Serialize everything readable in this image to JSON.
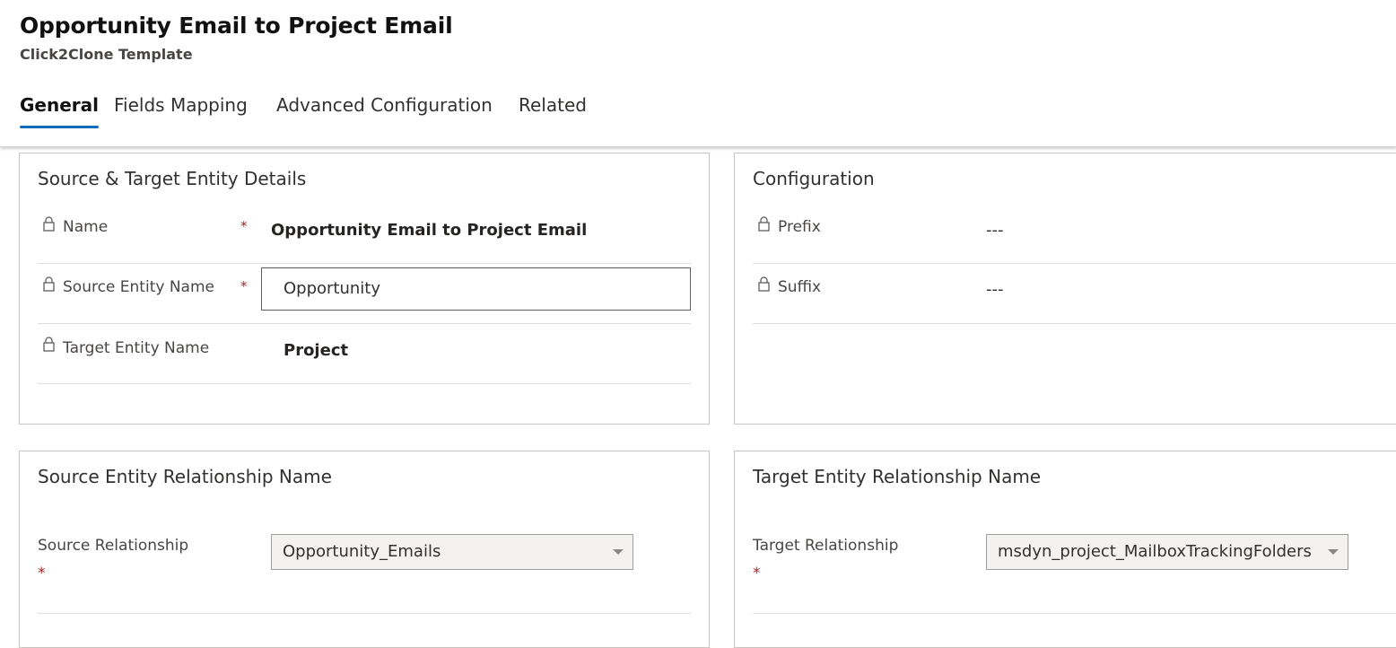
{
  "header": {
    "title": "Opportunity Email to Project Email",
    "subtitle": "Click2Clone Template"
  },
  "tabs": [
    {
      "label": "General",
      "active": true
    },
    {
      "label": "Fields Mapping",
      "active": false
    },
    {
      "label": "Advanced Configuration",
      "active": false
    },
    {
      "label": "Related",
      "active": false
    }
  ],
  "source_target": {
    "title": "Source & Target Entity Details",
    "fields": [
      {
        "label": "Name",
        "required_mark": "*",
        "value": "Opportunity Email to Project Email"
      },
      {
        "label": "Source Entity Name",
        "required_mark": "*",
        "value": "Opportunity"
      },
      {
        "label": "Target Entity Name",
        "value": "Project"
      }
    ]
  },
  "configuration": {
    "title": "Configuration",
    "fields": [
      {
        "label": "Prefix",
        "value": "---"
      },
      {
        "label": "Suffix",
        "value": "---"
      }
    ]
  },
  "source_relationship": {
    "title": "Source Entity Relationship Name",
    "label": "Source Relationship",
    "required_mark": "*",
    "selected": "Opportunity_Emails"
  },
  "target_relationship": {
    "title": "Target Entity Relationship Name",
    "label": "Target Relationship",
    "required_mark": "*",
    "selected": "msdyn_project_MailboxTrackingFolders"
  },
  "colors": {
    "accent": "#0f6cbd",
    "required": "#a4262c",
    "border": "#c8c6c4"
  },
  "icons": {
    "field_lock": "lock-icon",
    "dropdown": "chevron-down-icon"
  }
}
